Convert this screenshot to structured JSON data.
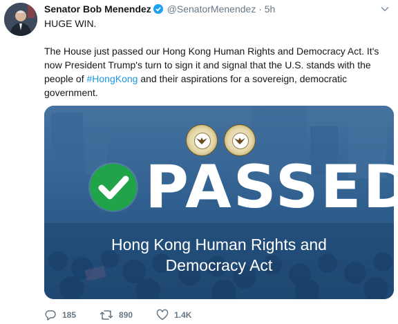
{
  "tweet": {
    "author_name": "Senator Bob Menendez",
    "handle": "@SenatorMenendez",
    "separator": "·",
    "time": "5h",
    "text_line1": "HUGE WIN.",
    "text_para2_before": "The House just passed our Hong Kong Human Rights and Democracy Act. It's now President Trump's turn to sign it and signal that the U.S. stands with the people of ",
    "hashtag": "#HongKong",
    "text_para2_after": " and their aspirations for a sovereign, democratic government."
  },
  "card": {
    "headline": "PASSED",
    "subtitle_line1": "Hong Kong Human Rights and",
    "subtitle_line2": "Democracy Act",
    "colors": {
      "overlay": "#2f5f8e",
      "check": "#21a34a"
    }
  },
  "actions": {
    "replies": "185",
    "retweets": "890",
    "likes": "1.4K"
  },
  "icons": [
    "verified-icon",
    "chevron-down-icon",
    "checkmark-icon",
    "reply-icon",
    "retweet-icon",
    "like-icon"
  ]
}
